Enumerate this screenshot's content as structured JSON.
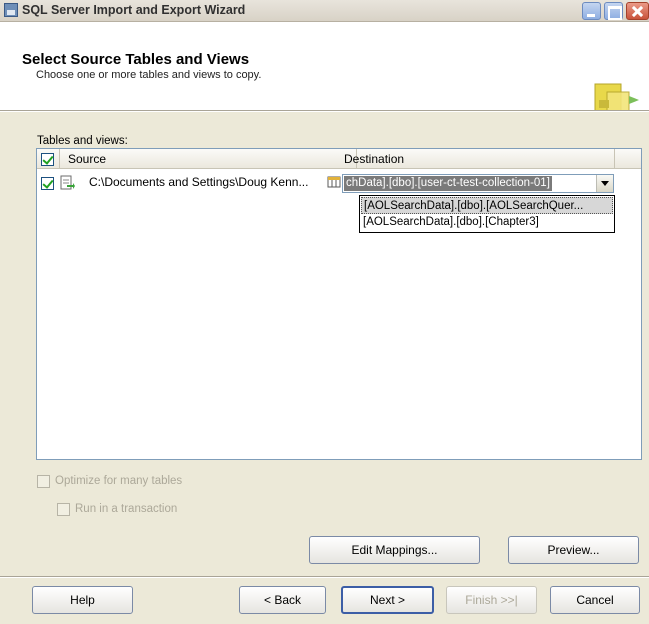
{
  "window": {
    "title": "SQL Server Import and Export Wizard"
  },
  "header": {
    "title": "Select Source Tables and Views",
    "subtitle": "Choose one or more tables and views to copy."
  },
  "tables": {
    "label": "Tables and views:",
    "columns": {
      "source": "Source",
      "destination": "Destination"
    },
    "rows": [
      {
        "checked": true,
        "source": "C:\\Documents and Settings\\Doug Kenn...",
        "destination": "chData].[dbo].[user-ct-test-collection-01]"
      }
    ],
    "destination_options": [
      "[AOLSearchData].[dbo].[AOLSearchQuer...",
      "[AOLSearchData].[dbo].[Chapter3]"
    ]
  },
  "options": {
    "optimize_label": "Optimize for many tables",
    "transaction_label": "Run in a transaction"
  },
  "buttons": {
    "edit_mappings": "Edit Mappings...",
    "preview": "Preview...",
    "help": "Help",
    "back": "< Back",
    "next": "Next >",
    "finish": "Finish >>|",
    "cancel": "Cancel"
  },
  "colors": {
    "dialog_bg": "#ece9d8",
    "grid_border": "#7f9db9",
    "checkmark": "#21a121",
    "disabled_text": "#aca899"
  }
}
